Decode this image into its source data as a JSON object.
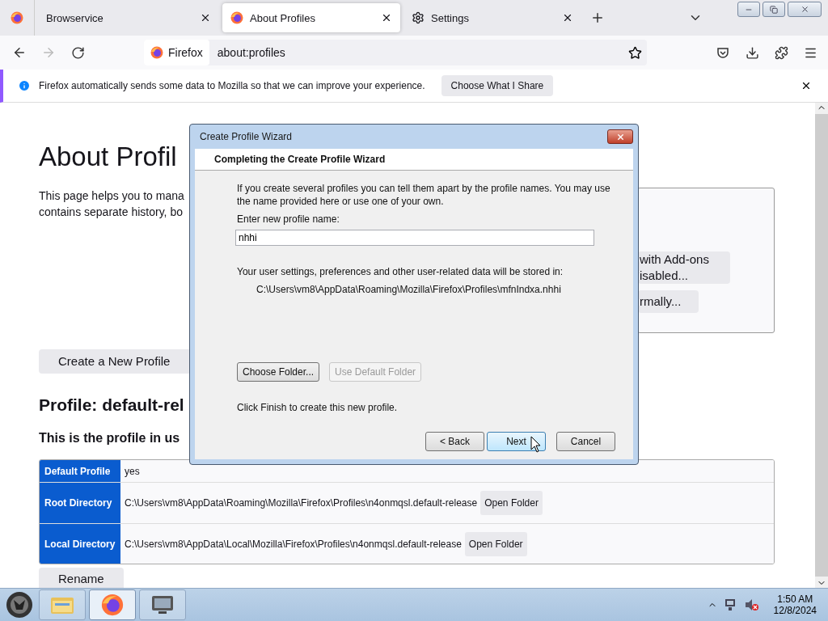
{
  "tabs": [
    {
      "label": "Browservice",
      "kind": "plain",
      "selected": false
    },
    {
      "label": "About Profiles",
      "kind": "page",
      "selected": true
    },
    {
      "label": "Settings",
      "kind": "settings",
      "selected": false
    }
  ],
  "address_bar": {
    "identity": "Firefox",
    "url": "about:profiles"
  },
  "notification": {
    "text": "Firefox automatically sends some data to Mozilla so that we can improve your experience.",
    "button": "Choose What I Share"
  },
  "page": {
    "title": "About Profil",
    "description": [
      "This page helps you to mana",
      "contains separate history, bo"
    ],
    "restart_buttons": [
      {
        "lines": [
          "with Add-ons",
          "isabled..."
        ]
      },
      {
        "lines": [
          "rmally..."
        ]
      }
    ],
    "create_button": "Create a New Profile",
    "profile_heading": "Profile: default-rel",
    "profile_note": "This is the profile in us",
    "table": {
      "rows": [
        {
          "label": "Default Profile",
          "value": "yes"
        },
        {
          "label": "Root Directory",
          "value": "C:\\Users\\vm8\\AppData\\Roaming\\Mozilla\\Firefox\\Profiles\\n4onmqsl.default-release",
          "button": "Open Folder"
        },
        {
          "label": "Local Directory",
          "value": "C:\\Users\\vm8\\AppData\\Local\\Mozilla\\Firefox\\Profiles\\n4onmqsl.default-release",
          "button": "Open Folder"
        }
      ]
    },
    "rename_button": "Rename"
  },
  "dialog": {
    "title": "Create Profile Wizard",
    "header": "Completing the Create Profile Wizard",
    "intro": "If you create several profiles you can tell them apart by the profile names. You may use the name provided here or use one of your own.",
    "name_label": "Enter new profile name:",
    "name_value": "nhhi",
    "storage_label": "Your user settings, preferences and other user-related data will be stored in:",
    "storage_path": "C:\\Users\\vm8\\AppData\\Roaming\\Mozilla\\Firefox\\Profiles\\mfnIndxa.nhhi",
    "folder_buttons": [
      {
        "label": "Choose Folder...",
        "disabled": false
      },
      {
        "label": "Use Default Folder",
        "disabled": true
      }
    ],
    "finish_note": "Click Finish to create this new profile.",
    "nav_buttons": [
      {
        "label": "< Back",
        "hovered": false
      },
      {
        "label": "Next",
        "hovered": true
      },
      {
        "label": "Cancel",
        "hovered": false
      }
    ]
  },
  "taskbar": {
    "items": [
      {
        "kind": "explorer",
        "selected": false
      },
      {
        "kind": "firefox",
        "selected": true
      },
      {
        "kind": "app",
        "selected": false
      }
    ],
    "time": "1:50 AM",
    "date": "12/8/2024"
  }
}
